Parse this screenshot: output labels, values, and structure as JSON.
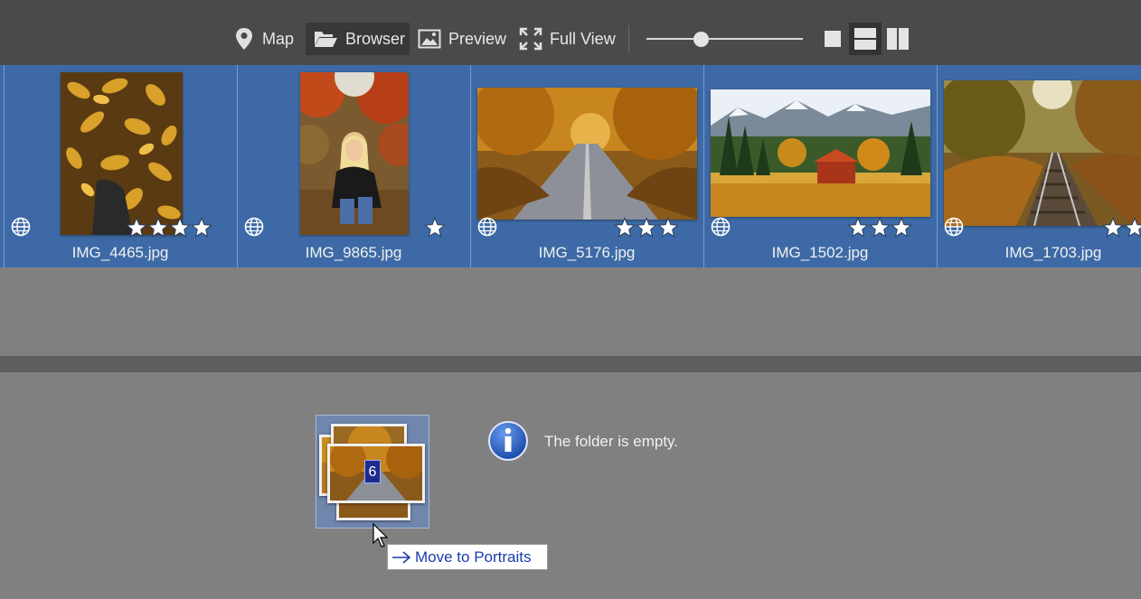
{
  "toolbar": {
    "map_label": "Map",
    "browser_label": "Browser",
    "preview_label": "Preview",
    "fullview_label": "Full View",
    "active_tab": "Browser",
    "zoom_fraction": 0.35
  },
  "thumbnails": [
    {
      "filename": "IMG_4465.jpg",
      "rating": 4
    },
    {
      "filename": "IMG_9865.jpg",
      "rating": 1
    },
    {
      "filename": "IMG_5176.jpg",
      "rating": 3
    },
    {
      "filename": "IMG_1502.jpg",
      "rating": 3
    },
    {
      "filename": "IMG_1703.jpg",
      "rating": 2
    }
  ],
  "drag": {
    "count": "6",
    "tooltip": "Move to Portraits"
  },
  "folder": {
    "empty_message": "The folder is empty."
  },
  "colors": {
    "selection": "#3d6aa6",
    "toolbar": "#4a4a4a",
    "background": "#808080"
  }
}
